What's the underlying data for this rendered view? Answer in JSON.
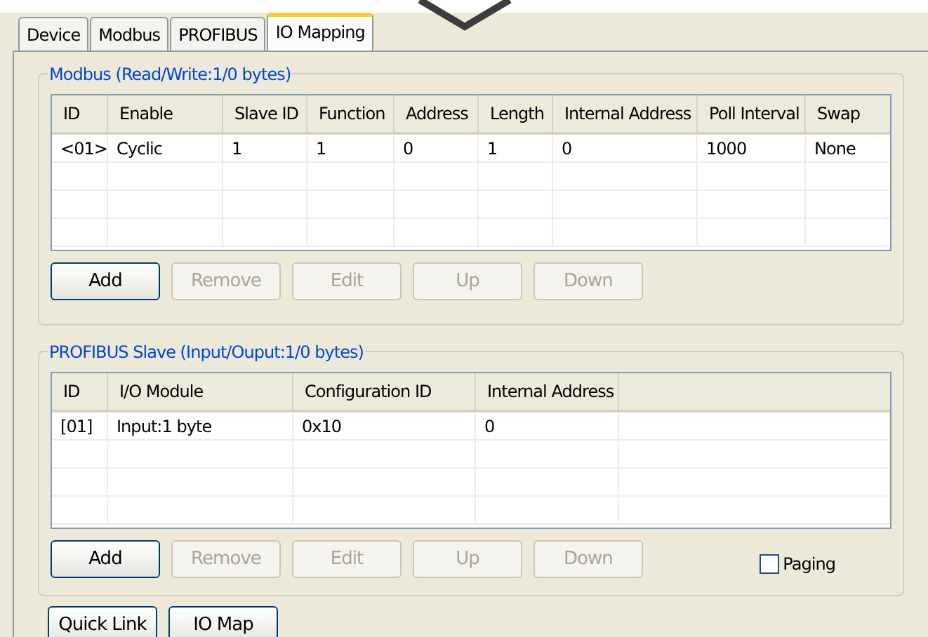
{
  "tabs": [
    {
      "label": "Device",
      "selected": false
    },
    {
      "label": "Modbus",
      "selected": false
    },
    {
      "label": "PROFIBUS",
      "selected": false
    },
    {
      "label": "IO Mapping",
      "selected": true
    }
  ],
  "modbus": {
    "title": "Modbus (Read/Write:1/0 bytes)",
    "columns": [
      "ID",
      "Enable",
      "Slave ID",
      "Function",
      "Address",
      "Length",
      "Internal Address",
      "Poll Interval",
      "Swap"
    ],
    "rows": [
      [
        "<01>",
        "Cyclic",
        "1",
        "1",
        "0",
        "1",
        "0",
        "1000",
        "None"
      ]
    ],
    "buttons": [
      {
        "label": "Add",
        "disabled": false
      },
      {
        "label": "Remove",
        "disabled": true
      },
      {
        "label": "Edit",
        "disabled": true
      },
      {
        "label": "Up",
        "disabled": true
      },
      {
        "label": "Down",
        "disabled": true
      }
    ]
  },
  "profibus": {
    "title": "PROFIBUS Slave (Input/Ouput:1/0 bytes)",
    "columns": [
      "ID",
      "I/O Module",
      "Configuration ID",
      "Internal Address"
    ],
    "rows": [
      [
        "[01]",
        "Input:1 byte",
        "0x10",
        "0"
      ]
    ],
    "buttons": [
      {
        "label": "Add",
        "disabled": false
      },
      {
        "label": "Remove",
        "disabled": true
      },
      {
        "label": "Edit",
        "disabled": true
      },
      {
        "label": "Up",
        "disabled": true
      },
      {
        "label": "Down",
        "disabled": true
      }
    ],
    "paging": {
      "label": "Paging",
      "checked": false
    }
  },
  "footer_buttons": [
    {
      "label": "Quick Link",
      "disabled": false
    },
    {
      "label": "IO Map",
      "disabled": false
    }
  ]
}
